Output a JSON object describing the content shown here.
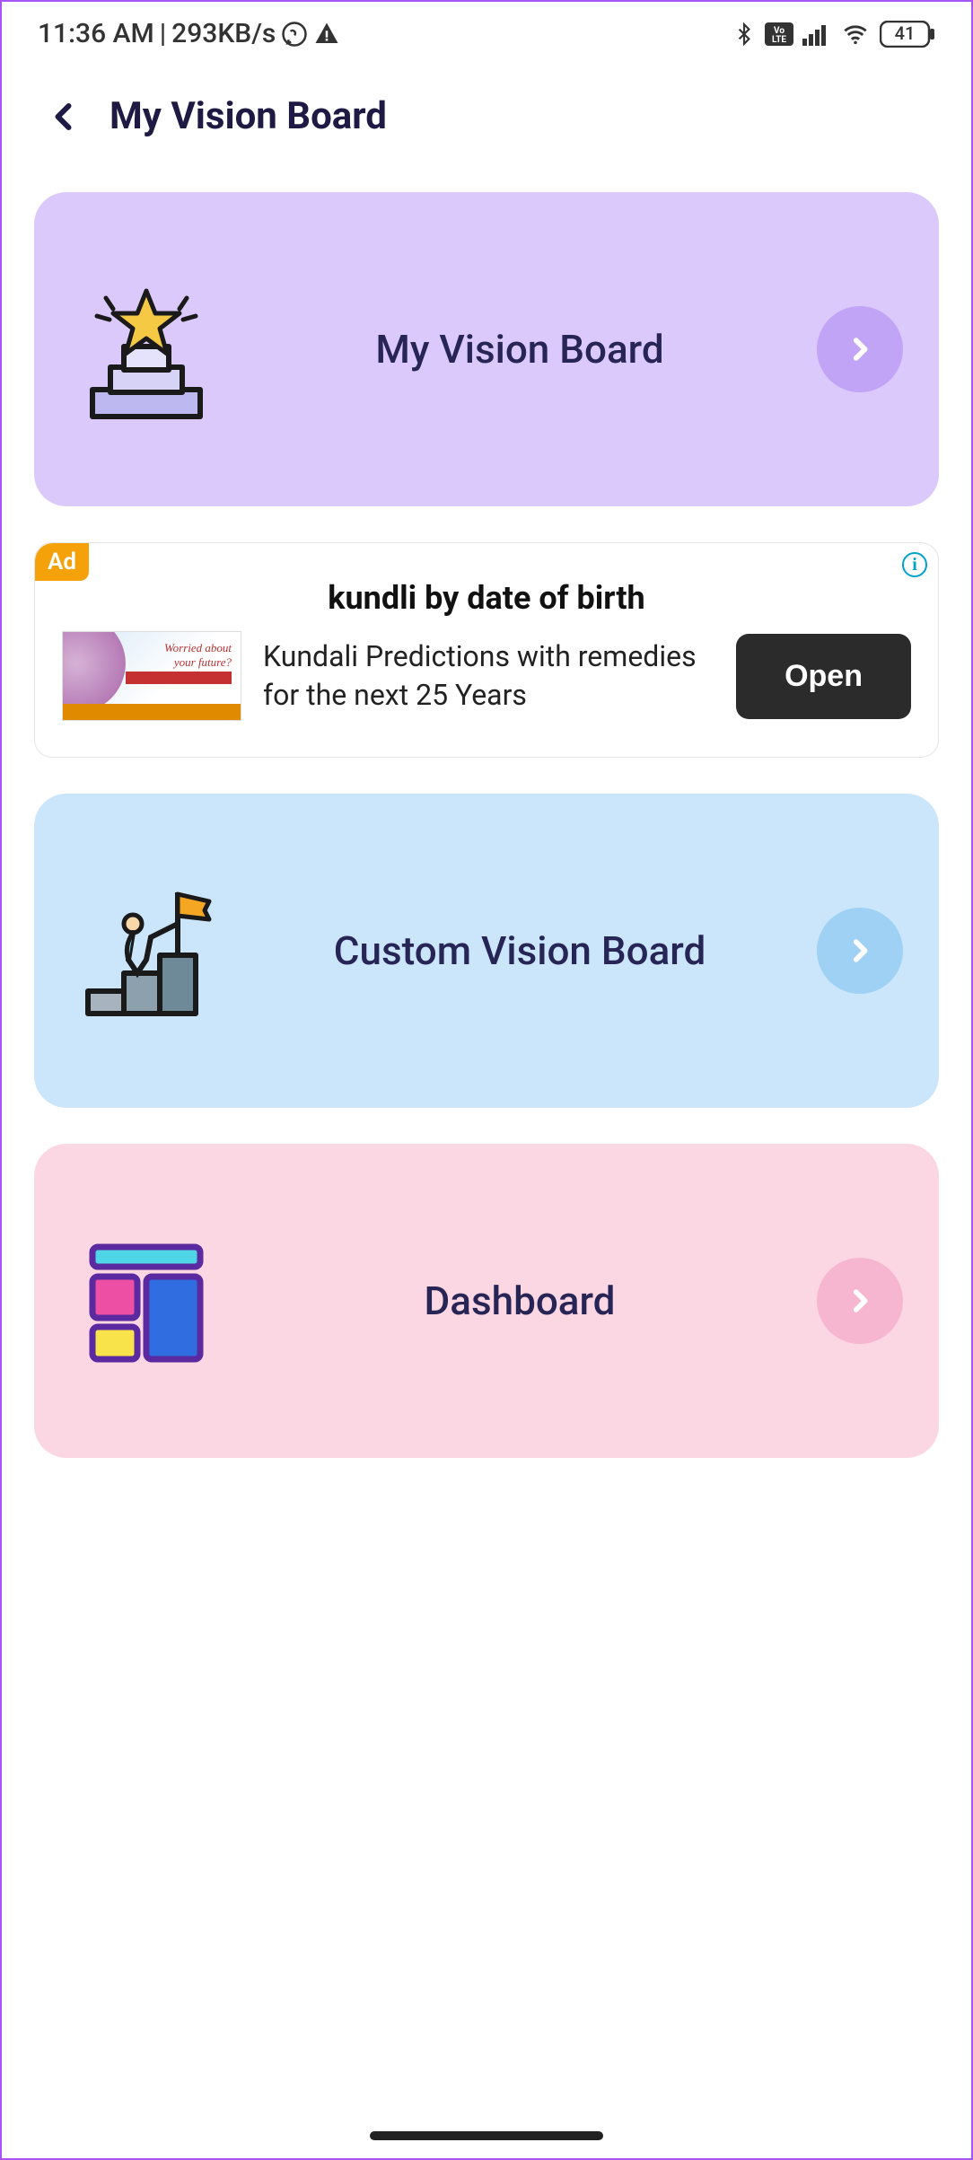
{
  "status_bar": {
    "time": "11:36 AM",
    "separator": " | ",
    "data_rate": "293KB/s",
    "battery": "41"
  },
  "header": {
    "title": "My Vision Board"
  },
  "cards": [
    {
      "id": "my-vision-board",
      "label": "My Vision Board",
      "color": "purple",
      "icon": "trophy-star"
    },
    {
      "id": "custom-vision-board",
      "label": "Custom Vision Board",
      "color": "blue",
      "icon": "person-flag"
    },
    {
      "id": "dashboard",
      "label": "Dashboard",
      "color": "pink",
      "icon": "dashboard-tiles"
    }
  ],
  "ad": {
    "badge": "Ad",
    "title": "kundli by date of birth",
    "description": "Kundali Predictions with remedies for the next 25 Years",
    "button": "Open",
    "thumb_line1": "Worried about",
    "thumb_line2": "your future?"
  }
}
